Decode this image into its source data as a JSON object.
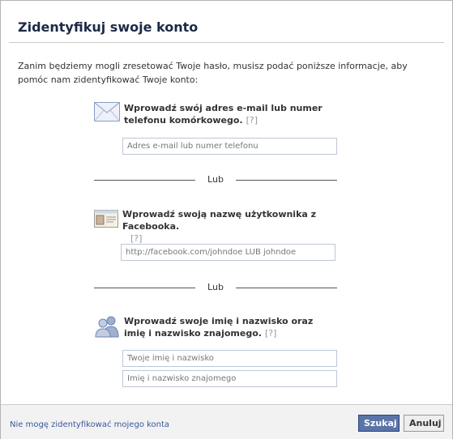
{
  "dialog": {
    "title": "Zidentyfikuj swoje konto",
    "intro": "Zanim będziemy mogli zresetować Twoje hasło, musisz podać poniższe informacje, aby pomóc nam zidentyfikować Twoje konto:"
  },
  "sections": {
    "email": {
      "label": "Wprowadź swój adres e-mail lub numer telefonu komórkowego.",
      "help": "[?]",
      "placeholder": "Adres e-mail lub numer telefonu",
      "icon": "envelope-icon"
    },
    "username": {
      "label": "Wprowadź swoją nazwę użytkownika z Facebooka.",
      "help": "[?]",
      "placeholder": "http://facebook.com/johndoe LUB johndoe",
      "icon": "id-card-icon"
    },
    "name": {
      "label": "Wprowadź swoje imię i nazwisko oraz imię i nazwisko znajomego.",
      "help": "[?]",
      "placeholder_own": "Twoje imię i nazwisko",
      "placeholder_friend": "Imię i nazwisko znajomego",
      "icon": "people-icon"
    }
  },
  "separator": {
    "or_label_1": "Lub",
    "or_label_2": "Lub"
  },
  "footer": {
    "link": "Nie mogę zidentyfikować mojego konta",
    "search_button": "Szukaj",
    "cancel_button": "Anuluj"
  },
  "colors": {
    "primary_button": "#5b74a8",
    "link": "#3b5998",
    "title": "#1c2a47"
  }
}
